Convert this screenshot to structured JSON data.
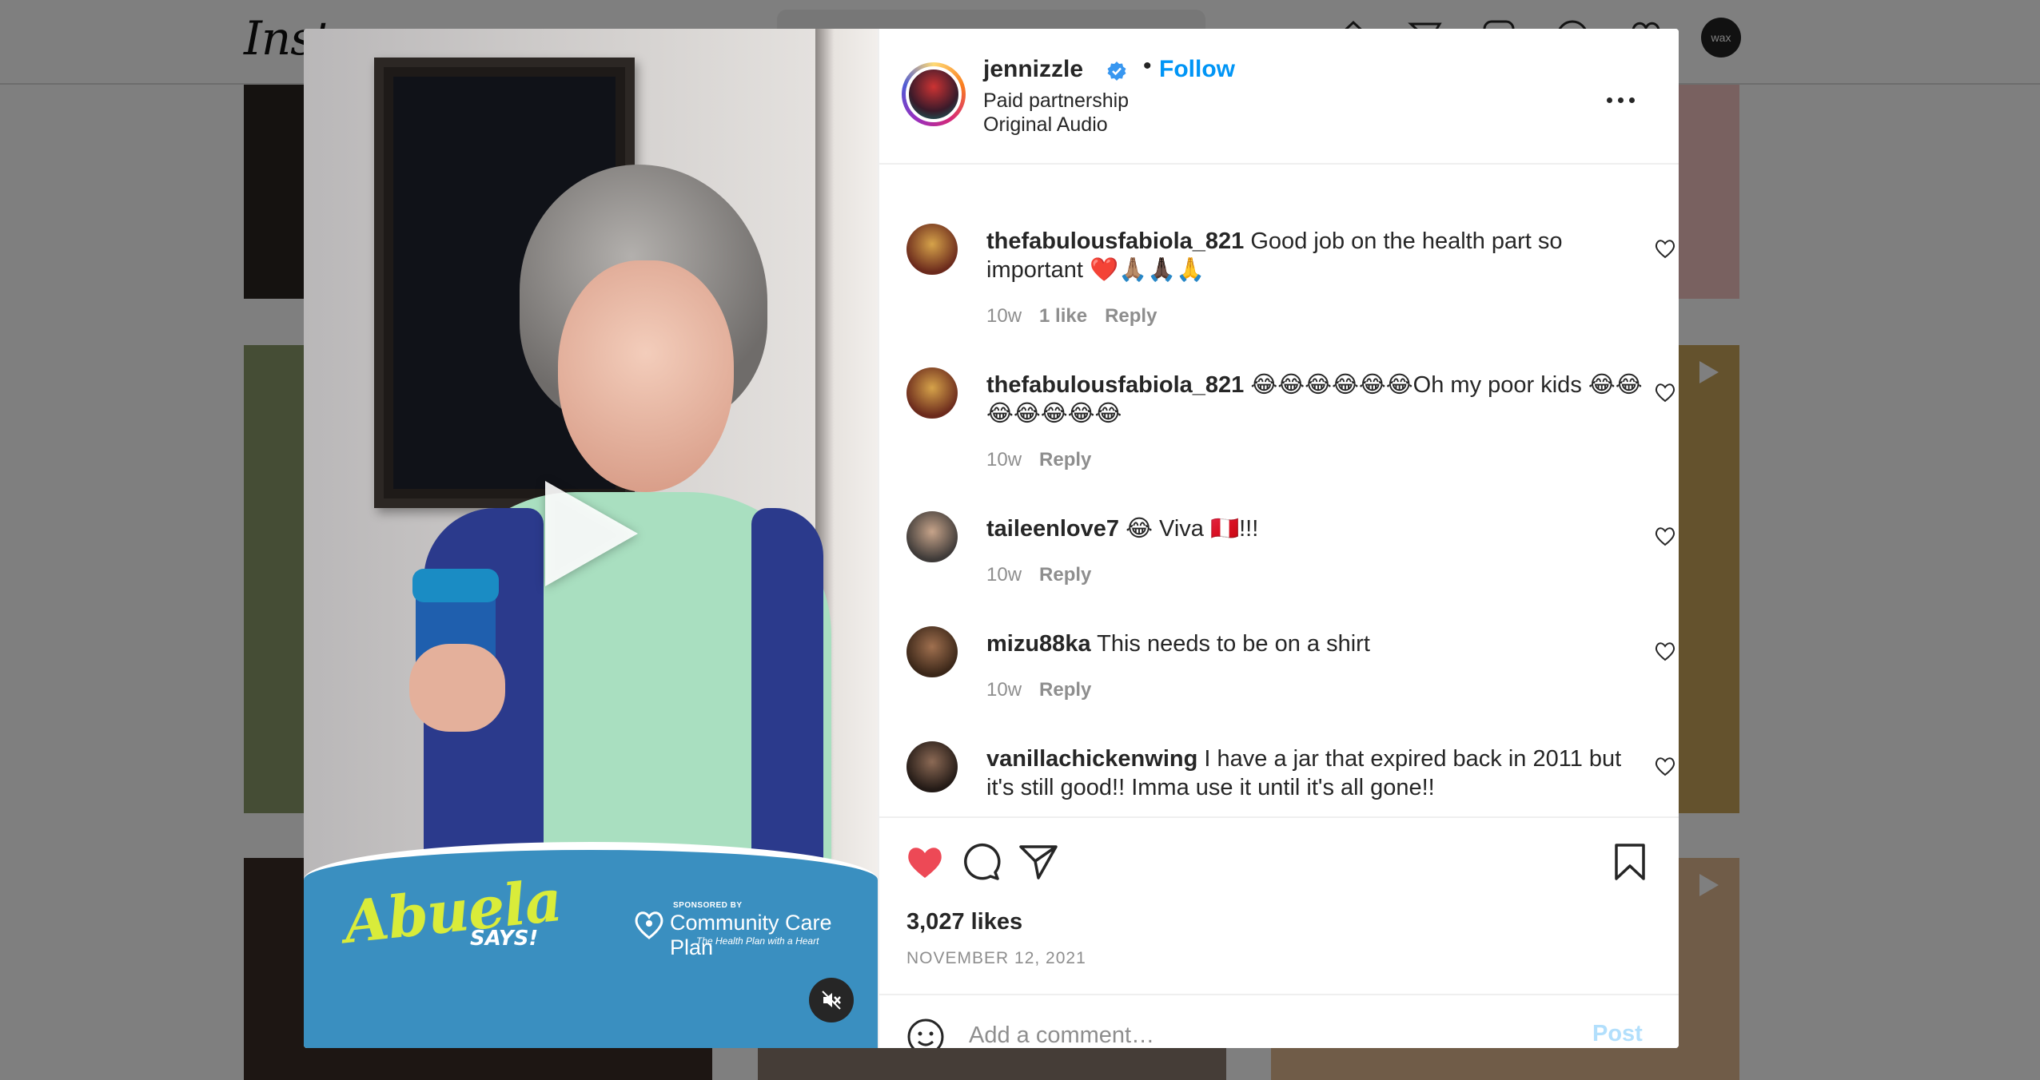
{
  "background": {
    "logo_text": "Inst",
    "profile_badge": "wax"
  },
  "video": {
    "overlay_title": "Abuela",
    "overlay_subtitle": "SAYS!",
    "sponsor_label": "SPONSORED BY",
    "sponsor_name": "Community Care Plan",
    "sponsor_tagline": "The Health Plan with a Heart"
  },
  "post": {
    "author": "jennizzle",
    "follow_label": "Follow",
    "separator": "•",
    "subtitle_1": "Paid partnership",
    "subtitle_2": "Original Audio",
    "likes": "3,027 likes",
    "date": "NOVEMBER 12, 2021"
  },
  "comments": [
    {
      "user": "thefabulousfabiola_821",
      "text": "Good job on the health part so important ❤️🙏🏽🙏🏿🙏",
      "time": "10w",
      "likes": "1 like",
      "reply": "Reply"
    },
    {
      "user": "thefabulousfabiola_821",
      "text": "😂😂😂😂😂😂Oh my poor kids 😂😂😂😂😂😂😂",
      "time": "10w",
      "likes": "",
      "reply": "Reply"
    },
    {
      "user": "taileenlove7",
      "text": "😂 Viva 🇵🇪!!!",
      "time": "10w",
      "likes": "",
      "reply": "Reply"
    },
    {
      "user": "mizu88ka",
      "text": "This needs to be on a shirt",
      "time": "10w",
      "likes": "",
      "reply": "Reply"
    },
    {
      "user": "vanillachickenwing",
      "text": "I have a jar that expired back in 2011 but it's still good!! Imma use it until it's all gone!!",
      "time": "",
      "likes": "",
      "reply": ""
    }
  ],
  "composer": {
    "placeholder": "Add a comment…",
    "post_label": "Post"
  },
  "colors": {
    "link_blue": "#0095f6",
    "like_red": "#ed4956",
    "post_disabled": "#b2dffc",
    "banner_blue": "#3a8fc0"
  },
  "icons": {
    "actions": [
      "heart-filled-icon",
      "comment-icon",
      "share-icon",
      "bookmark-icon"
    ],
    "header": [
      "verified-badge-icon",
      "more-options-icon"
    ],
    "video": [
      "play-icon",
      "muted-speaker-icon"
    ]
  }
}
